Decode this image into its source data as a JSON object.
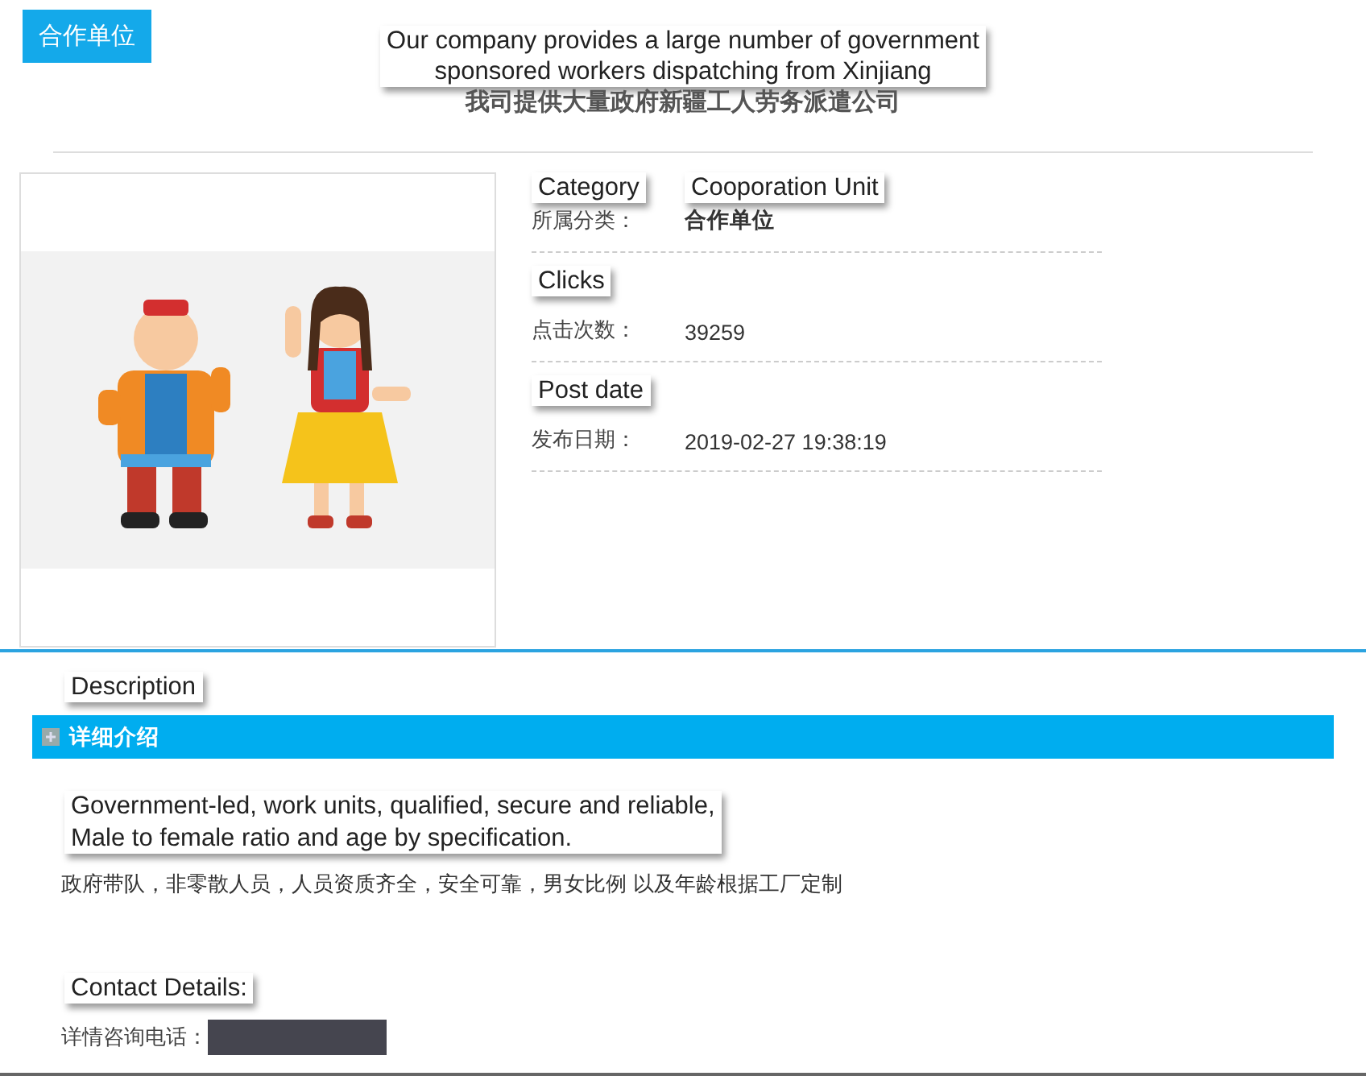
{
  "badge": "合作单位",
  "header": {
    "title_translation_lines": [
      "Our company provides a large number of government",
      "sponsored workers dispatching from Xinjiang"
    ],
    "title": "我司提供大量政府新疆工人劳务派遣公司"
  },
  "info_rows": [
    {
      "label_translation": "Category",
      "label": "所属分类：",
      "value_translation": "Cooporation Unit",
      "value": "合作单位",
      "kind": "strong"
    },
    {
      "label_translation": "Clicks",
      "label": "点击次数：",
      "value": "39259",
      "kind": "plain"
    },
    {
      "label_translation": "Post date",
      "label": "发布日期：",
      "value": "2019-02-27 19:38:19",
      "kind": "plain"
    }
  ],
  "description": {
    "heading_translation": "Description",
    "heading": "详细介绍",
    "body_translation_lines": [
      "Government-led, work units, qualified, secure and reliable,",
      "Male to female ratio and age by specification."
    ],
    "body": "政府带队，非零散人员，人员资质齐全，安全可靠，男女比例 以及年龄根据工厂定制"
  },
  "contact": {
    "heading_translation": "Contact Details:",
    "label": "详情咨询电话："
  }
}
